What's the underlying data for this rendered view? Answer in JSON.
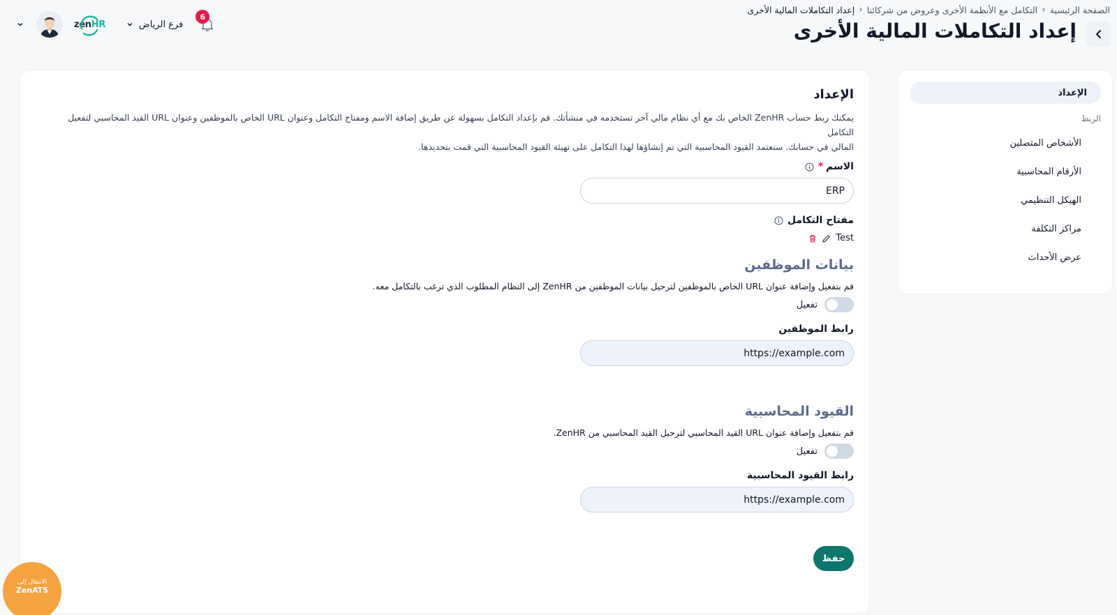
{
  "breadcrumb": {
    "home": "الصفحة الرئيسية",
    "parent": "التكامل مع الأنظمة الأخرى وعروض من شركائنا",
    "current": "إعداد التكاملات المالية الأخرى"
  },
  "page_title": "إعداد التكاملات المالية الأخرى",
  "header": {
    "branch": "فرع الرياض",
    "notifications_count": "6",
    "logo": "zenHR"
  },
  "sidebar": {
    "active_item": "الإعداد",
    "group_label": "الربط",
    "items": [
      {
        "label": "الأشخاص المتصلين"
      },
      {
        "label": "الأرقام المحاسبية"
      },
      {
        "label": "الهيكل التنظيمي"
      },
      {
        "label": "مراكز التكلفة"
      },
      {
        "label": "عرض الأحداث"
      }
    ]
  },
  "main": {
    "title": "الإعداد",
    "intro_line1": "يمكنك ربط حساب ZenHR الخاص بك مع أي نظام مالي آخر تستخدمه في منشأتك. قم بإعداد التكامل بسهولة عن طريق إضافة الاسم ومفتاح التكامل وعنوان URL الخاص بالموظفين وعنوان URL القيد المحاسبي لتفعيل التكامل",
    "intro_line2": "المالي في حسابك. ستعتمد القيود المحاسبية التي تم إنشاؤها لهذا التكامل على تهيئة القيود المحاسبية التي قمت بتحديدها.",
    "name_label": "الاسم",
    "name_required": "*",
    "name_value": "ERP",
    "key_label": "مفتاح التكامل",
    "key_value": "Test",
    "employees": {
      "title": "بيانات الموظفين",
      "description": "قم بتفعيل وإضافة عنوان URL الخاص بالموظفين لترحيل بيانات الموظفين من ZenHR إلى النظام المطلوب الذي ترغب بالتكامل معه.",
      "toggle_label": "تفعيل",
      "url_label": "رابط الموظفين",
      "url_value": "https://example.com"
    },
    "journal": {
      "title": "القيود المحاسبية",
      "description": "قم بتفعيل وإضافة عنوان URL القيد المحاسبي لترحيل القيد المحاسبي من ZenHR.",
      "toggle_label": "تفعيل",
      "url_label": "رابط القيود المحاسبية",
      "url_value": "https://example.com"
    },
    "save_label": "حفظ"
  },
  "zenats": {
    "line1": "الانتقال إلى",
    "line2": "ZenATS"
  }
}
